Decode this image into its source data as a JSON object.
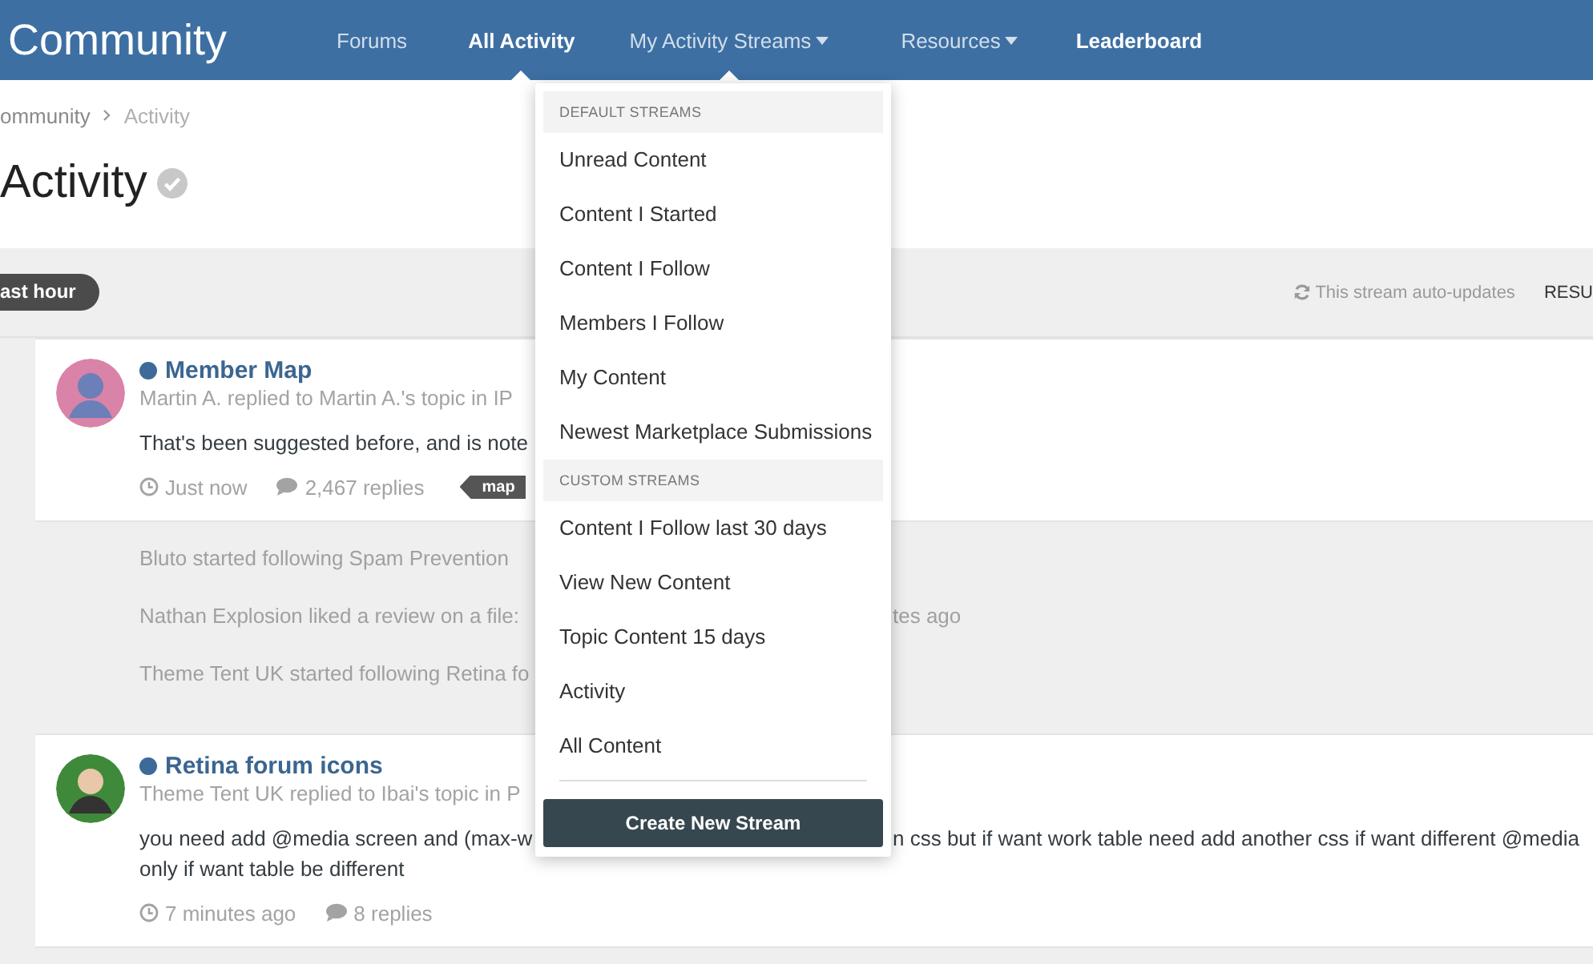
{
  "header": {
    "logo": "Community",
    "nav": [
      {
        "label": "Forums",
        "selected": false,
        "highlighted": false,
        "has_menu": false,
        "open": false
      },
      {
        "label": "All Activity",
        "selected": true,
        "highlighted": false,
        "has_menu": false,
        "open": false
      },
      {
        "label": "My Activity Streams",
        "selected": false,
        "highlighted": false,
        "has_menu": true,
        "open": true
      },
      {
        "label": "Resources",
        "selected": false,
        "highlighted": false,
        "has_menu": true,
        "open": false
      },
      {
        "label": "Leaderboard",
        "selected": false,
        "highlighted": true,
        "has_menu": false,
        "open": false
      }
    ]
  },
  "breadcrumb": [
    "ommunity",
    "Activity"
  ],
  "page_title": "Activity",
  "stream_bar": {
    "filter": "ast hour",
    "auto_update": "This stream auto-updates",
    "action": "RESU"
  },
  "feed": [
    {
      "kind": "post",
      "unread": true,
      "title": "Member Map",
      "meta": "Martin A. replied to Martin A.'s topic in IP",
      "body": [
        {
          "left": "That's been suggested before, and is note"
        }
      ],
      "time": "Just now",
      "replies": "2,467 replies",
      "tags": [
        "map"
      ]
    },
    {
      "kind": "activity",
      "text": "Bluto started following Spam Prevention"
    },
    {
      "kind": "activity",
      "text": "Nathan Explosion liked a review on a file:",
      "time": "tes ago"
    },
    {
      "kind": "activity",
      "text": "Theme Tent UK started following Retina fo"
    },
    {
      "kind": "post",
      "unread": true,
      "title": "Retina forum icons",
      "meta": "Theme Tent UK replied to Ibai's topic in P",
      "body": [
        {
          "left": "you need add @media screen and (max-w",
          "right": "n css but if want work table need add another css if want different @media"
        },
        {
          "left": "only if want table be different"
        }
      ],
      "time": "7 minutes ago",
      "replies": "8 replies"
    }
  ],
  "menu": {
    "sections": [
      {
        "heading": "DEFAULT STREAMS",
        "items": [
          "Unread Content",
          "Content I Started",
          "Content I Follow",
          "Members I Follow",
          "My Content",
          "Newest Marketplace Submissions"
        ]
      },
      {
        "heading": "CUSTOM STREAMS",
        "items": [
          "Content I Follow last 30 days",
          "View New Content",
          "Topic Content 15 days",
          "Activity",
          "All Content"
        ]
      }
    ],
    "button": "Create New Stream"
  }
}
